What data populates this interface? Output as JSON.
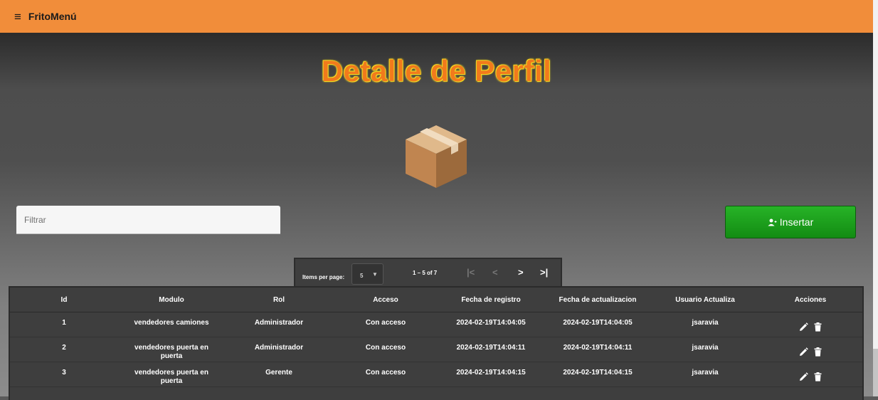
{
  "app": {
    "title": "FritoMenú",
    "menu_icon": "hamburger-menu-icon"
  },
  "page": {
    "title": "Detalle de Perfil"
  },
  "filter": {
    "label": "Filtrar"
  },
  "insert_button": {
    "label": "Insertar",
    "icon": "person-add-icon"
  },
  "paginator": {
    "items_per_page_label": "Items per page:",
    "items_per_page_value": "5",
    "range_label": "1 – 5 of 7",
    "first_icon": "|<",
    "prev_icon": "<",
    "next_icon": ">",
    "last_icon": ">|"
  },
  "table": {
    "columns": [
      "Id",
      "Modulo",
      "Rol",
      "Acceso",
      "Fecha de registro",
      "Fecha de actualizacion",
      "Usuario Actualiza",
      "Acciones"
    ],
    "rows": [
      {
        "id": "1",
        "modulo": "vendedores camiones",
        "rol": "Administrador",
        "acceso": "Con acceso",
        "registro": "2024-02-19T14:04:05",
        "actualizacion": "2024-02-19T14:04:05",
        "usuario": "jsaravia"
      },
      {
        "id": "2",
        "modulo": "vendedores puerta en puerta",
        "rol": "Administrador",
        "acceso": "Con acceso",
        "registro": "2024-02-19T14:04:11",
        "actualizacion": "2024-02-19T14:04:11",
        "usuario": "jsaravia"
      },
      {
        "id": "3",
        "modulo": "vendedores puerta en puerta",
        "rol": "Gerente",
        "acceso": "Con acceso",
        "registro": "2024-02-19T14:04:15",
        "actualizacion": "2024-02-19T14:04:15",
        "usuario": "jsaravia"
      }
    ]
  },
  "colors": {
    "topbar": "#f18d3a",
    "title": "#f17a1c",
    "insert_button": "#1a9e1a",
    "table_bg": "#3e3e3e"
  }
}
